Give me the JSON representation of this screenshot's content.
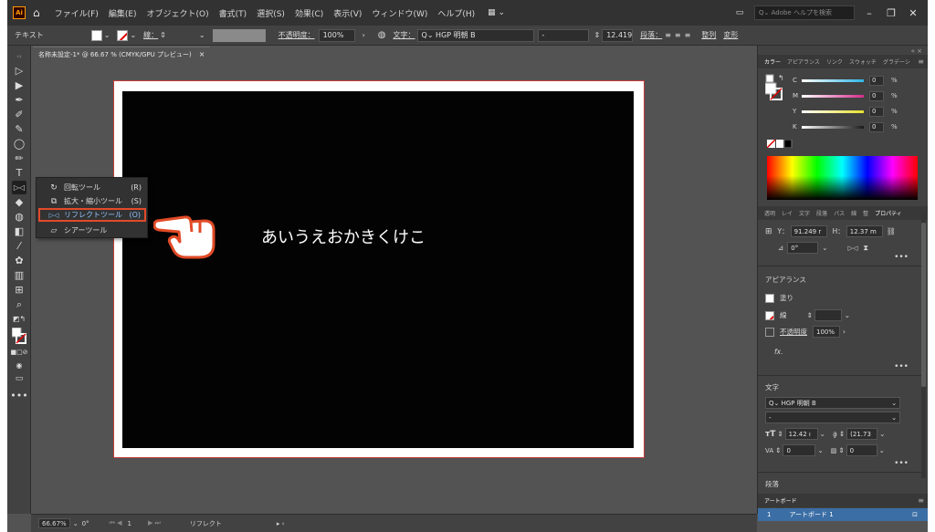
{
  "menu": {
    "logo": "Ai",
    "items": [
      "ファイル(F)",
      "編集(E)",
      "オブジェクト(O)",
      "書式(T)",
      "選択(S)",
      "効果(C)",
      "表示(V)",
      "ウィンドウ(W)",
      "ヘルプ(H)"
    ],
    "workspace": "▦ ⌄",
    "search_placeholder": "Q⌄ Adobe ヘルプを検索"
  },
  "control": {
    "mode": "テキスト",
    "stroke_label": "線：",
    "opacity_label": "不透明度：",
    "opacity_value": "100%",
    "char_label": "文字：",
    "font": "Q⌄ HGP 明朝 B",
    "font_style": "-",
    "font_size": "12.419",
    "para_label": "段落：",
    "align_label": "整列",
    "transform_label": "変形"
  },
  "doc_tab": {
    "title": "名称未設定-1* @ 66.67 % (CMYK/GPU プレビュー)",
    "close": "×"
  },
  "artboard": {
    "text": "あいうえおかきくけこ"
  },
  "flyout": {
    "items": [
      {
        "label": "回転ツール",
        "key": "(R)"
      },
      {
        "label": "拡大・縮小ツール",
        "key": "(S)"
      },
      {
        "label": "リフレクトツール",
        "key": "(O)"
      },
      {
        "label": "シアーツール",
        "key": ""
      }
    ]
  },
  "color_panel": {
    "tabs": [
      "カラー",
      "アピアランス",
      "リンク",
      "スウォッチ",
      "グラデーシ"
    ],
    "channels": [
      {
        "label": "C",
        "value": "0",
        "unit": "%",
        "color": "#2fb6e6"
      },
      {
        "label": "M",
        "value": "0",
        "unit": "%",
        "color": "#d42c8c"
      },
      {
        "label": "Y",
        "value": "0",
        "unit": "%",
        "color": "#e8e030"
      },
      {
        "label": "K",
        "value": "0",
        "unit": "%",
        "color": "#1a1a1a"
      }
    ]
  },
  "props_panel": {
    "tabs": [
      "透明",
      "レイ",
      "文字",
      "段落",
      "パス",
      "線",
      "整",
      "プロパティ"
    ],
    "y_label": "Y：",
    "y_value": "91.249 r",
    "h_label": "H：",
    "h_value": "12.37 m",
    "angle_value": "0°",
    "appearance_title": "アピアランス",
    "fill_label": "塗り",
    "stroke_label": "線",
    "opacity_label": "不透明度",
    "opacity_value": "100%",
    "fx": "fx.",
    "char_title": "文字",
    "font": "Q⌄ HGP 明朝 B",
    "style": "-",
    "size": "12.42 ı",
    "leading": "(21.73",
    "tracking": "0",
    "kerning": "0",
    "para_title": "段落"
  },
  "artboards_panel": {
    "title": "アートボード",
    "row_num": "1",
    "row_name": "アートボード 1"
  },
  "status": {
    "zoom": "66.67%",
    "rotation": "0°",
    "page": "1",
    "tool": "リフレクト"
  }
}
